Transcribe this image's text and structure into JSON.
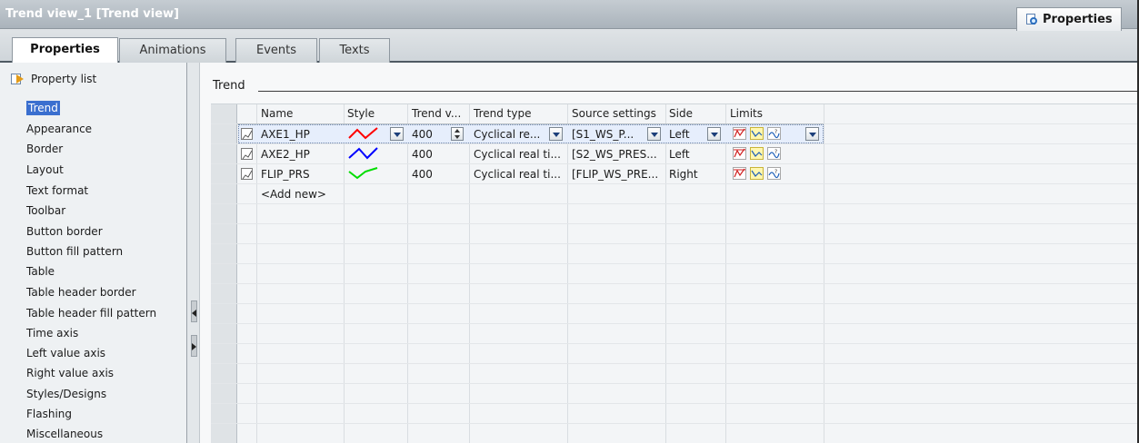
{
  "window": {
    "title": "Trend view_1 [Trend view]",
    "properties_button": "Properties"
  },
  "tabs": [
    {
      "label": "Properties",
      "active": true
    },
    {
      "label": "Animations",
      "active": false
    },
    {
      "label": "Events",
      "active": false
    },
    {
      "label": "Texts",
      "active": false
    }
  ],
  "property_list": {
    "header": "Property list",
    "items": [
      {
        "label": "Trend",
        "selected": true
      },
      {
        "label": "Appearance"
      },
      {
        "label": "Border"
      },
      {
        "label": "Layout"
      },
      {
        "label": "Text format"
      },
      {
        "label": "Toolbar"
      },
      {
        "label": "Button border"
      },
      {
        "label": "Button fill pattern"
      },
      {
        "label": "Table"
      },
      {
        "label": "Table header border"
      },
      {
        "label": "Table header fill pattern"
      },
      {
        "label": "Time axis"
      },
      {
        "label": "Left value axis"
      },
      {
        "label": "Right value axis"
      },
      {
        "label": "Styles/Designs"
      },
      {
        "label": "Flashing"
      },
      {
        "label": "Miscellaneous"
      }
    ]
  },
  "section": {
    "title": "Trend"
  },
  "table": {
    "columns": [
      "Name",
      "Style",
      "Trend v...",
      "Trend type",
      "Source settings",
      "Side",
      "Limits"
    ],
    "rows": [
      {
        "name": "AXE1_HP",
        "style_color": "#ff0000",
        "trend_values": "400",
        "trend_type": "Cyclical re...",
        "source": "[S1_WS_P...",
        "side": "Left",
        "editing": true
      },
      {
        "name": "AXE2_HP",
        "style_color": "#0000ff",
        "trend_values": "400",
        "trend_type": "Cyclical real ti...",
        "source": "[S2_WS_PRES...",
        "side": "Left",
        "editing": false
      },
      {
        "name": "FLIP_PRS",
        "style_color": "#00dd00",
        "trend_values": "400",
        "trend_type": "Cyclical real ti...",
        "source": "[FLIP_WS_PRE...",
        "side": "Right",
        "editing": false
      }
    ],
    "add_new": "<Add new>"
  },
  "colors": {
    "selection": "#3a6fcf",
    "header_bg": "#dfe3e6"
  }
}
